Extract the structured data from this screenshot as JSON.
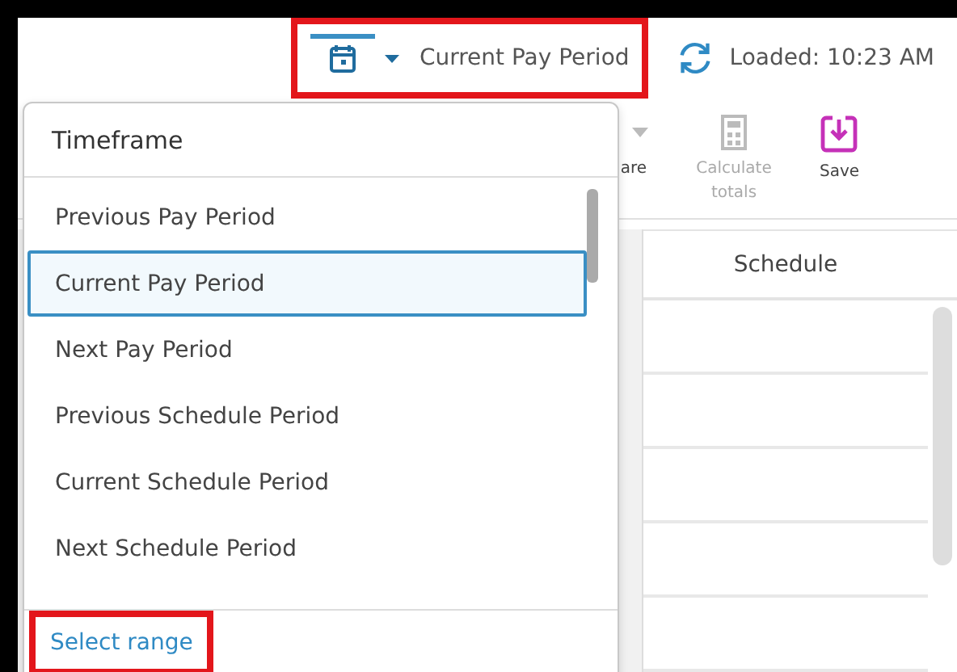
{
  "header": {
    "timeframe_button": {
      "label": "Current Pay Period",
      "highlighted": true
    },
    "refresh_status": "Loaded: 10:23 AM"
  },
  "toolbar": [
    {
      "kind": "share",
      "label": "are",
      "disabled": false
    },
    {
      "kind": "calculator",
      "label": "Calculate totals",
      "disabled": true
    },
    {
      "kind": "save",
      "label": "Save",
      "disabled": false
    }
  ],
  "table": {
    "columns": [
      "Schedule"
    ]
  },
  "dropdown": {
    "title": "Timeframe",
    "items": [
      {
        "label": "Previous Pay Period",
        "selected": false
      },
      {
        "label": "Current Pay Period",
        "selected": true
      },
      {
        "label": "Next Pay Period",
        "selected": false
      },
      {
        "label": "Previous Schedule Period",
        "selected": false
      },
      {
        "label": "Current Schedule Period",
        "selected": false
      },
      {
        "label": "Next Schedule Period",
        "selected": false
      }
    ],
    "footer_link": {
      "label": "Select range",
      "highlighted": true
    }
  }
}
